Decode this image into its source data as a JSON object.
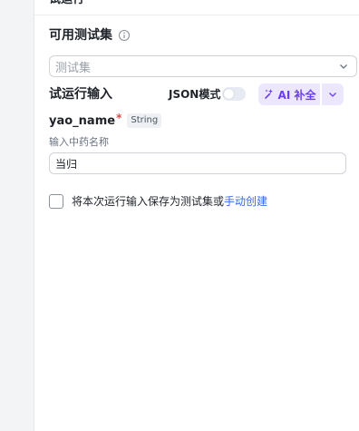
{
  "header": {
    "title": "试运行"
  },
  "dataset": {
    "title": "可用测试集",
    "placeholder": "测试集"
  },
  "run_input": {
    "title": "试运行输入",
    "json_mode_label": "JSON模式",
    "json_mode_on": false,
    "ai_button_label": "AI 补全"
  },
  "param": {
    "name": "yao_name",
    "required_mark": "*",
    "type": "String",
    "description": "输入中药名称",
    "value": "当归"
  },
  "save": {
    "label": "将本次运行输入保存为测试集或",
    "link": "手动创建",
    "checked": false
  },
  "colors": {
    "accent": "#6b3ff0",
    "link": "#3a67e8",
    "ai_bg": "#ede7fd"
  }
}
